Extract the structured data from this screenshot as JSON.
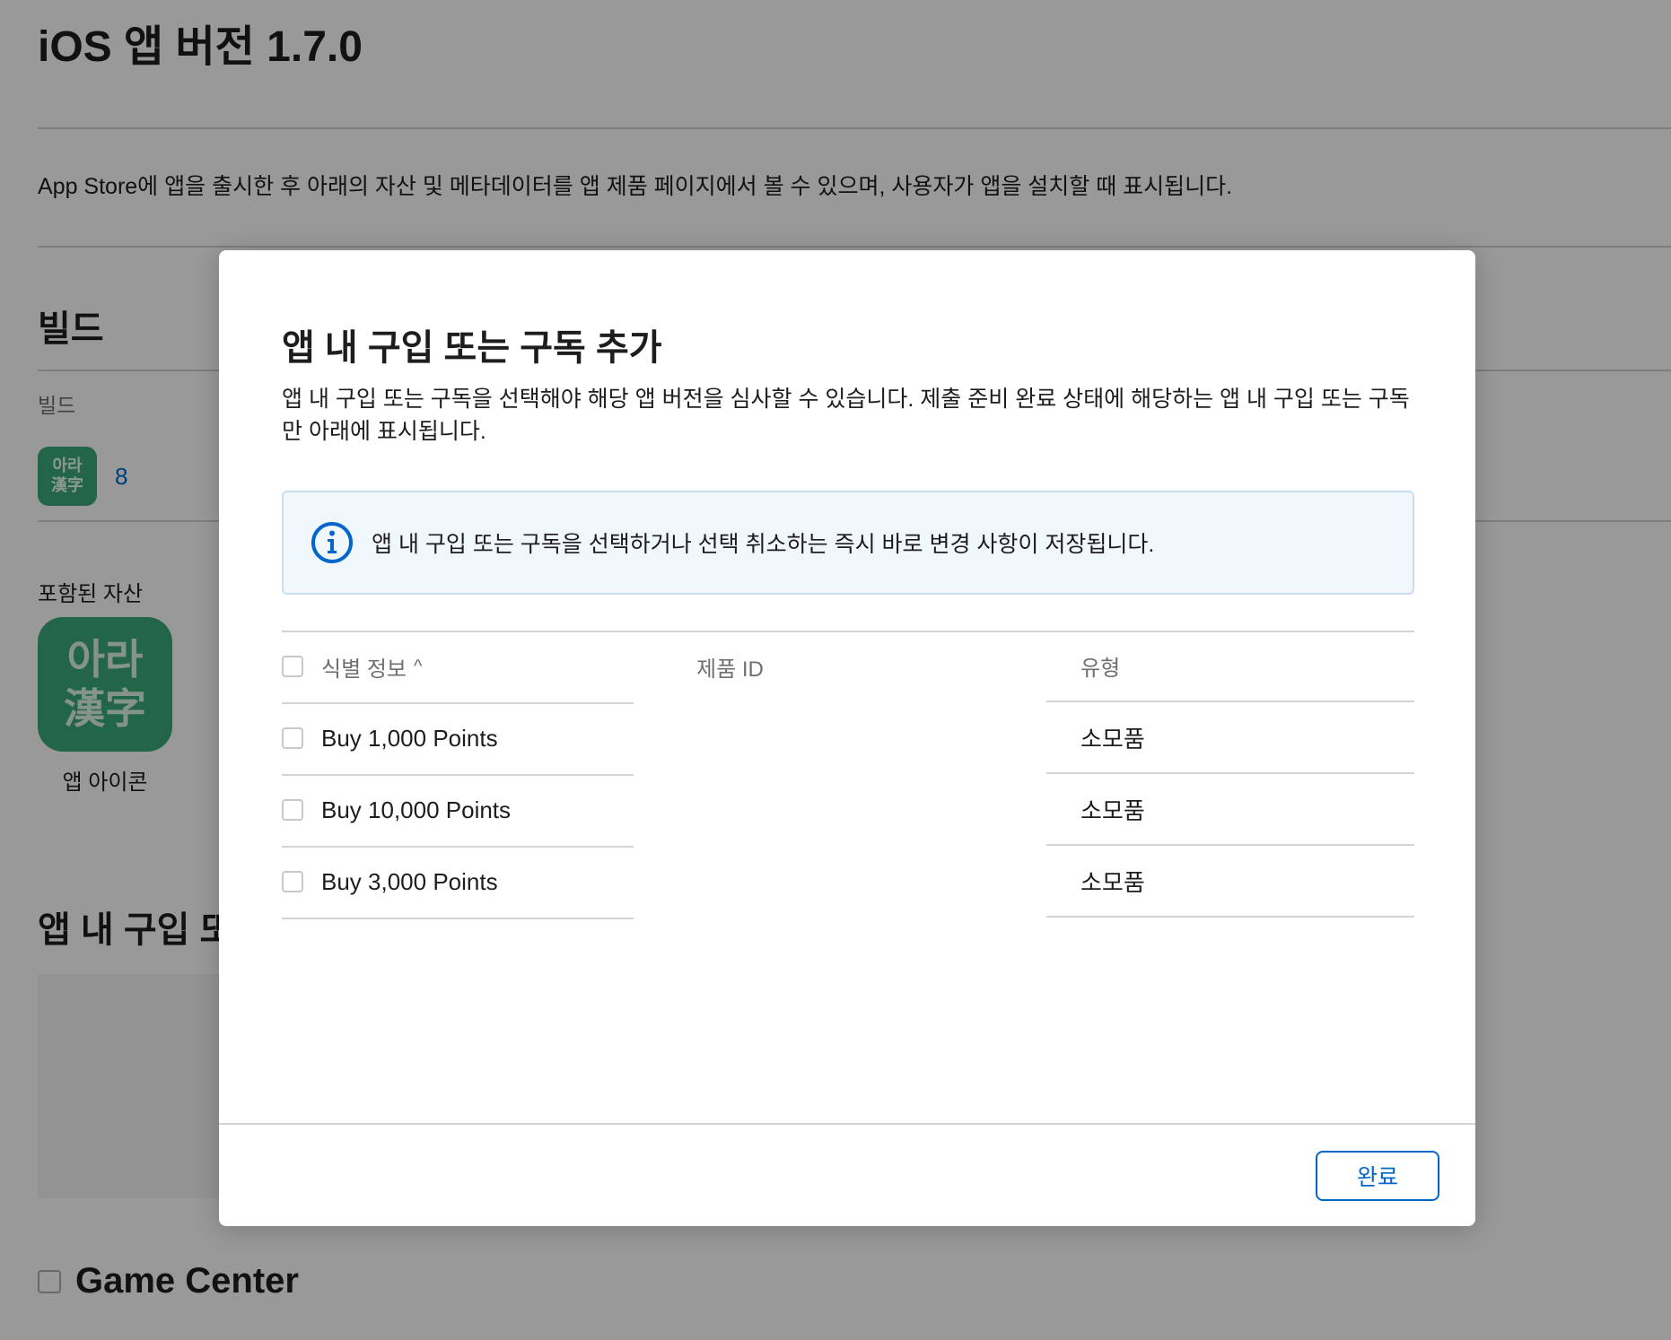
{
  "page": {
    "title": "iOS 앱 버전 1.7.0",
    "description": "App Store에 앱을 출시한 후 아래의 자산 및 메타데이터를 앱 제품 페이지에서 볼 수 있으며, 사용자가 앱을 설치할 때 표시됩니다."
  },
  "build_section": {
    "title": "빌드",
    "column_label": "빌드",
    "icon_text_line1": "아라",
    "icon_text_line2": "漢字",
    "build_number": "8",
    "included_assets_label": "포함된 자산",
    "asset_icon_line1": "아라",
    "asset_icon_line2": "漢字",
    "asset_caption": "앱 아이콘"
  },
  "iap_section": {
    "title": "앱 내 구입 또"
  },
  "game_center": {
    "title": "Game Center"
  },
  "modal": {
    "title": "앱 내 구입 또는 구독 추가",
    "description": "앱 내 구입 또는 구독을 선택해야 해당 앱 버전을 심사할 수 있습니다. 제출 준비 완료 상태에 해당하는 앱 내 구입 또는 구독만 아래에 표시됩니다.",
    "info_message": "앱 내 구입 또는 구독을 선택하거나 선택 취소하는 즉시 바로 변경 사항이 저장됩니다.",
    "info_icon": "info-circle-icon",
    "columns": {
      "name": "식별 정보",
      "product_id": "제품 ID",
      "type": "유형"
    },
    "sort_indicator": "^",
    "rows": [
      {
        "name": "Buy 1,000 Points",
        "product_id": "",
        "type": "소모품"
      },
      {
        "name": "Buy 10,000 Points",
        "product_id": "",
        "type": "소모품"
      },
      {
        "name": "Buy 3,000 Points",
        "product_id": "",
        "type": "소모품"
      }
    ],
    "done_label": "완료"
  },
  "colors": {
    "accent": "#0066cc",
    "icon_green": "#3aa87a",
    "info_background": "#f0f7fd"
  }
}
